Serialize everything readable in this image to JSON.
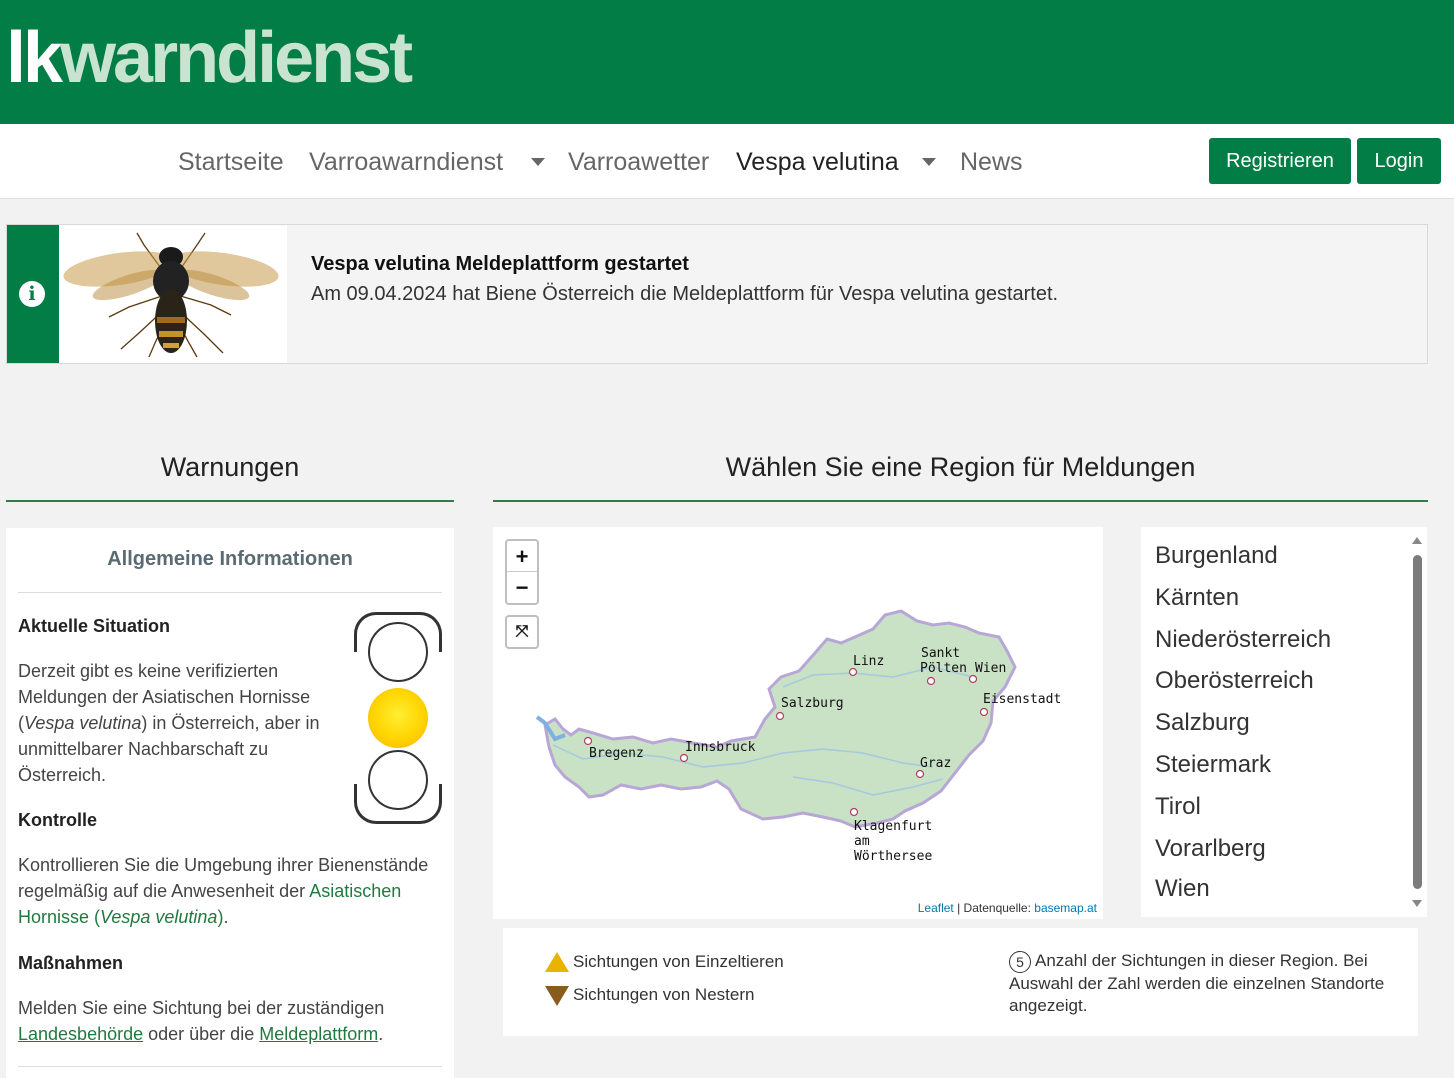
{
  "header": {
    "logo_part1": "lk",
    "logo_part2": "warndienst",
    "brand_color": "#037d46"
  },
  "nav": {
    "items": [
      {
        "label": "Startseite"
      },
      {
        "label": "Varroawarndienst"
      },
      {
        "label": "Varroawetter"
      },
      {
        "label": "Vespa velutina"
      },
      {
        "label": "News"
      }
    ],
    "register_label": "Registrieren",
    "login_label": "Login"
  },
  "announcement": {
    "title": "Vespa velutina Meldeplattform gestartet",
    "text": "Am 09.04.2024 hat Biene Österreich die Meldeplattform für Vespa velutina gestartet."
  },
  "warnings": {
    "section_title": "Warnungen",
    "card_title": "Allgemeine Informationen",
    "situation_heading": "Aktuelle Situation",
    "situation_lines": [
      "Derzeit gibt es keine verifizierten",
      "Meldungen der Asiatischen Hornisse",
      "in Österreich, aber in",
      "unmittelbarer Nachbarschaft zu",
      "Österreich."
    ],
    "situation_species": "Vespa velutina",
    "control_heading": "Kontrolle",
    "control_line1": "Kontrollieren Sie die Umgebung ihrer Bienenstände",
    "control_line2": "regelmäßig auf die Anwesenheit  der",
    "control_link1": "Asiatischen",
    "control_link2": "Hornisse (",
    "control_link_species": "Vespa velutina",
    "control_link_end": ")",
    "measures_heading": "Maßnahmen",
    "measures_line1": "Melden Sie eine Sichtung bei der zuständigen",
    "measures_link1": "Landesbehörde",
    "measures_mid": " oder über die ",
    "measures_link2": "Meldeplattform",
    "measures_end": ".",
    "traffic_light_level": "yellow"
  },
  "map": {
    "section_title": "Wählen Sie eine Region für Meldungen",
    "zoom_in": "+",
    "zoom_out": "−",
    "fullscreen_glyph": "⤧",
    "cities": [
      "Linz",
      "Sankt",
      "Pölten",
      "Wien",
      "Eisenstadt",
      "Salzburg",
      "Bregenz",
      "Innsbruck",
      "Graz",
      "Klagenfurt",
      "am",
      "Wörthersee"
    ],
    "attribution_leaflet": "Leaflet",
    "attribution_sep": " | Datenquelle: ",
    "attribution_source": "basemap.at"
  },
  "regions": [
    "Burgenland",
    "Kärnten",
    "Niederösterreich",
    "Oberösterreich",
    "Salzburg",
    "Steiermark",
    "Tirol",
    "Vorarlberg",
    "Wien"
  ],
  "legend": {
    "single": "Sichtungen von Einzeltieren",
    "nests": "Sichtungen von Nestern",
    "count_example": "5",
    "count_text": "Anzahl der Sichtungen in dieser Region. Bei Auswahl der Zahl werden die einzelnen Standorte angezeigt."
  }
}
